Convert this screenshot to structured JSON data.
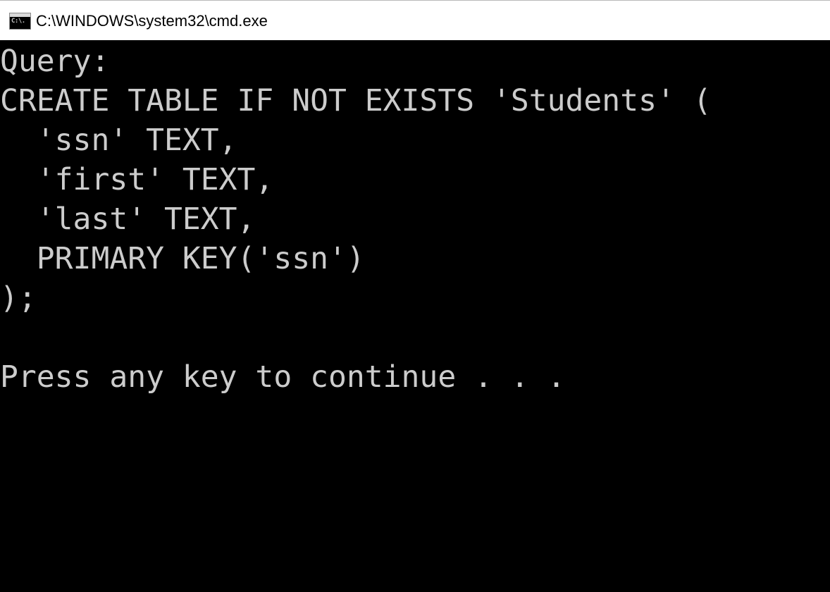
{
  "window": {
    "title": "C:\\WINDOWS\\system32\\cmd.exe",
    "icon": "cmd-console-icon",
    "icon_glyph": "C:\\."
  },
  "console": {
    "lines": [
      "Query:",
      "CREATE TABLE IF NOT EXISTS 'Students' (",
      "  'ssn' TEXT,",
      "  'first' TEXT,",
      "  'last' TEXT,",
      "  PRIMARY KEY('ssn')",
      ");",
      "",
      "Press any key to continue . . ."
    ],
    "colors": {
      "background": "#000000",
      "text": "#cccccc"
    }
  }
}
